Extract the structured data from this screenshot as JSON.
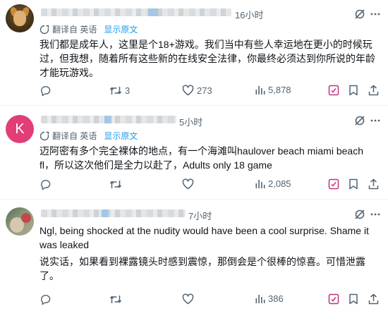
{
  "posts": [
    {
      "avatar_letter": "",
      "time": "16小时",
      "translated_by": "翻译自 英语",
      "show_original": "显示原文",
      "text": "我们都是成年人，这里是个18+游戏。我们当中有些人幸运地在更小的时候玩过，但我想，随着所有这些新的在线安全法律，你最终必须达到你所说的年龄才能玩游戏。",
      "stats": {
        "replies": "",
        "retweets": "3",
        "likes": "273",
        "views": "5,878"
      }
    },
    {
      "avatar_letter": "K",
      "time": "5小时",
      "translated_by": "翻译自 英语",
      "show_original": "显示原文",
      "text": "迈阿密有多个完全裸体的地点，有一个海滩叫haulover beach miami beach fl，所以这次他们是全力以赴了，Adults only 18 game",
      "stats": {
        "replies": "",
        "retweets": "",
        "likes": "",
        "views": "2,085"
      }
    },
    {
      "avatar_letter": "",
      "time": "7小时",
      "text_original": "Ngl, being shocked at the nudity would have been a cool surprise. Shame it was leaked",
      "text_translation": "说实话，如果看到裸露镜头时感到震惊，那倒会是个很棒的惊喜。可惜泄露了。",
      "stats": {
        "replies": "",
        "retweets": "",
        "likes": "",
        "views": "386"
      }
    }
  ],
  "colors": {
    "text": "#0f1419",
    "secondary": "#536471",
    "link": "#1d9bf0",
    "divider": "#eff3f4",
    "avatar_k": "#e13e78"
  },
  "icons": [
    "grok-icon",
    "more-icon",
    "translate-icon",
    "reply-icon",
    "retweet-icon",
    "like-icon",
    "views-icon",
    "bookmark-icon",
    "share-icon"
  ]
}
